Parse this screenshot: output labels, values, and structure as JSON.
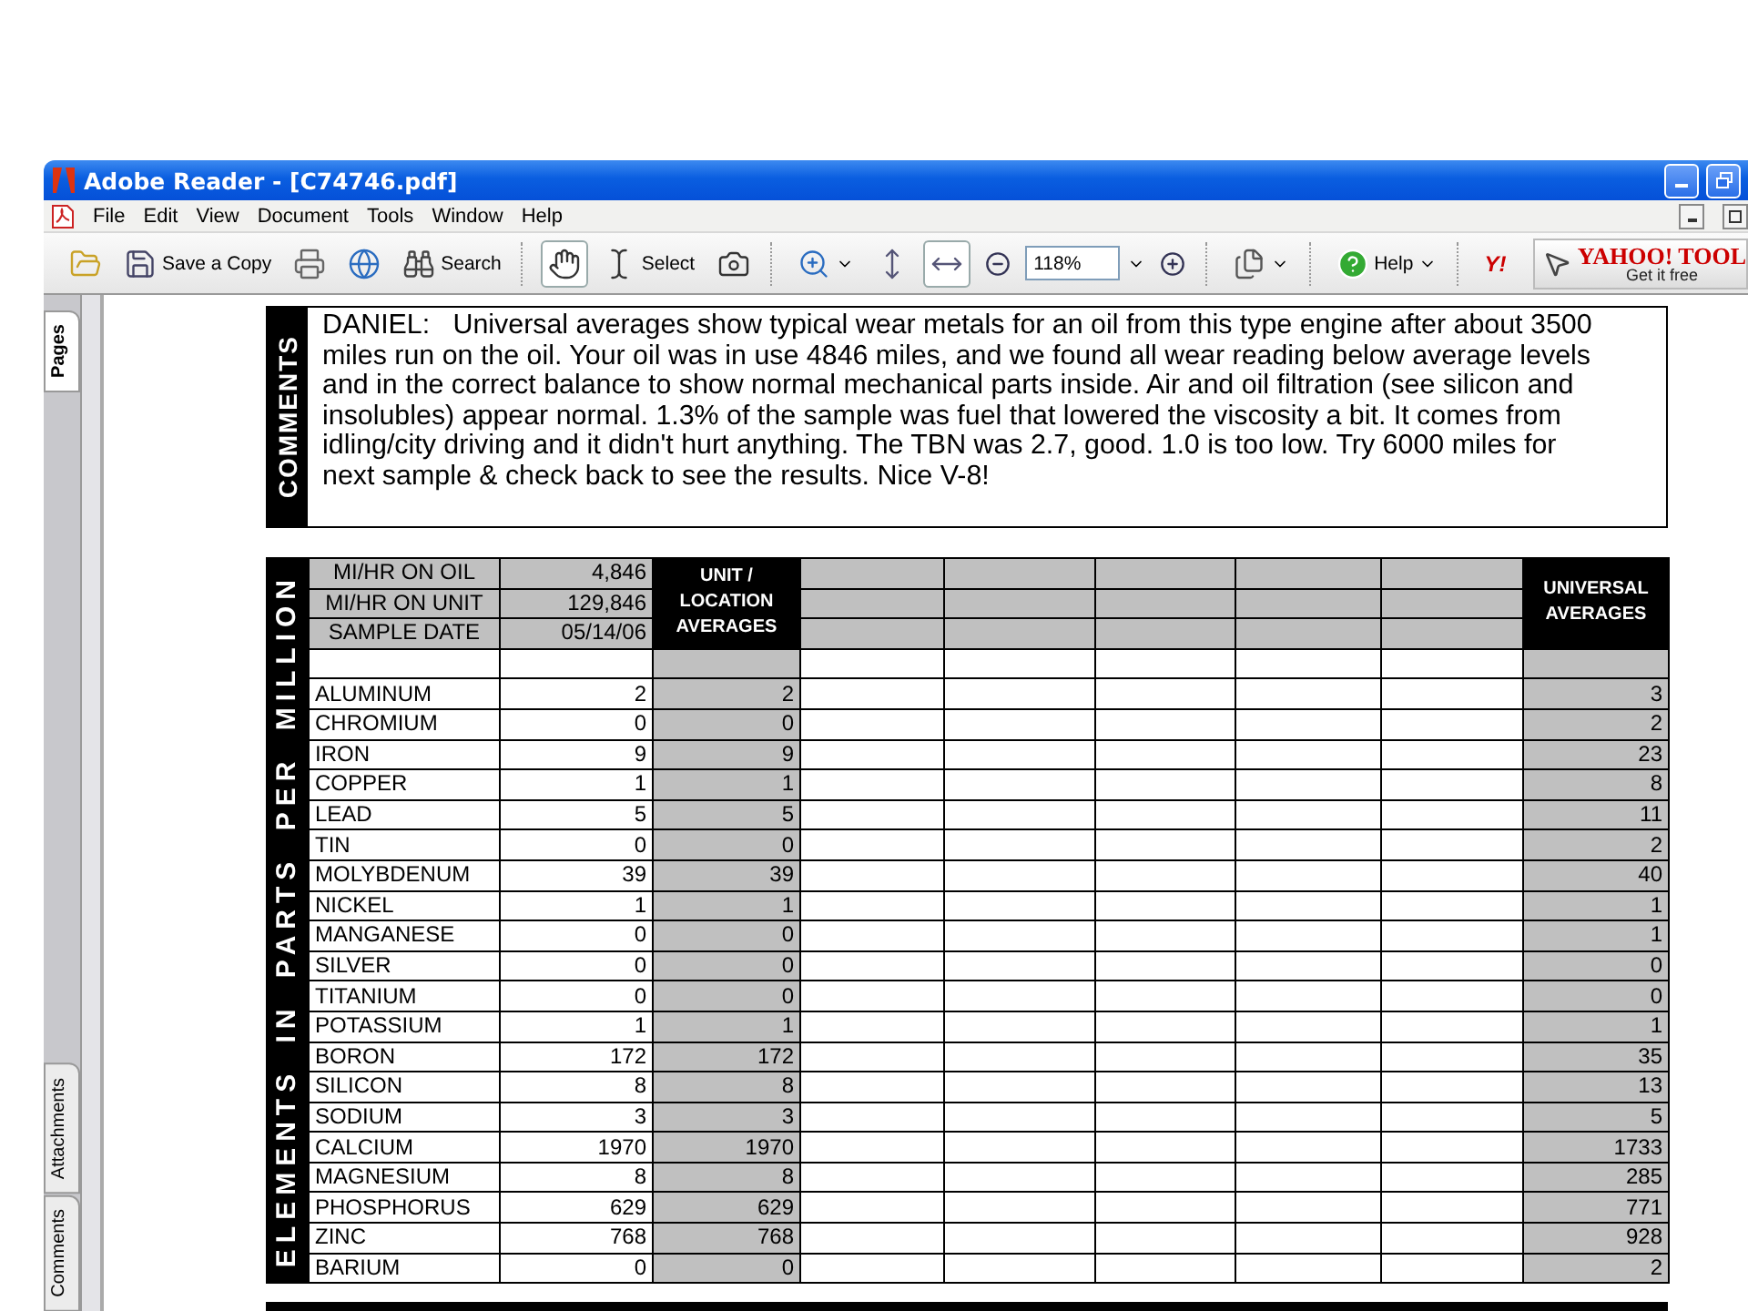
{
  "window": {
    "title": "Adobe Reader - [C74746.pdf]"
  },
  "menu": [
    "File",
    "Edit",
    "View",
    "Document",
    "Tools",
    "Window",
    "Help"
  ],
  "toolbar": {
    "save_copy": {
      "label": "Save a Copy"
    },
    "search": {
      "label": "Search"
    },
    "hand_tool": {
      "selected": true
    },
    "select_tool": {
      "label": "Select",
      "selected": false
    },
    "snapshot_tool": {
      "selected": false
    },
    "fit_page": {
      "selected": false
    },
    "fit_width": {
      "selected": true
    },
    "zoom": {
      "value": "118%"
    },
    "help": {
      "label": "Help"
    },
    "yahoo": {
      "label": "Y!"
    },
    "yahoo_toolbar": {
      "title": "YAHOO! TOOL",
      "subtitle": "Get it free"
    }
  },
  "side_tabs": [
    {
      "label": "Pages",
      "selected": true
    },
    {
      "label": "Attachments",
      "selected": false
    },
    {
      "label": "Comments",
      "selected": false
    }
  ],
  "comments": {
    "heading": "COMMENTS",
    "text": "DANIEL:   Universal averages show typical wear metals for an oil from this type engine after about 3500 miles run on the oil. Your oil was in use 4846 miles, and we found all wear reading below average levels and in the correct balance to show normal mechanical parts inside. Air and oil filtration (see silicon and insolubles) appear normal. 1.3% of the sample was fuel that lowered the viscosity a bit. It comes from idling/city driving and it didn't hurt anything. The TBN was 2.7, good. 1.0 is too low. Try 6000 miles for next sample & check back to see the results. Nice V-8!"
  },
  "report": {
    "side_label": "ELEMENTS IN PARTS PER MILLION",
    "unit_heading": "UNIT / LOCATION AVERAGES",
    "universal_heading": "UNIVERSAL AVERAGES",
    "info": [
      {
        "label": "MI/HR ON OIL",
        "value": "4,846"
      },
      {
        "label": "MI/HR ON UNIT",
        "value": "129,846"
      },
      {
        "label": "SAMPLE DATE",
        "value": "05/14/06"
      }
    ],
    "rows": [
      {
        "element": "ALUMINUM",
        "value": "2",
        "unit": "2",
        "universal": "3"
      },
      {
        "element": "CHROMIUM",
        "value": "0",
        "unit": "0",
        "universal": "2"
      },
      {
        "element": "IRON",
        "value": "9",
        "unit": "9",
        "universal": "23"
      },
      {
        "element": "COPPER",
        "value": "1",
        "unit": "1",
        "universal": "8"
      },
      {
        "element": "LEAD",
        "value": "5",
        "unit": "5",
        "universal": "11"
      },
      {
        "element": "TIN",
        "value": "0",
        "unit": "0",
        "universal": "2"
      },
      {
        "element": "MOLYBDENUM",
        "value": "39",
        "unit": "39",
        "universal": "40"
      },
      {
        "element": "NICKEL",
        "value": "1",
        "unit": "1",
        "universal": "1"
      },
      {
        "element": "MANGANESE",
        "value": "0",
        "unit": "0",
        "universal": "1"
      },
      {
        "element": "SILVER",
        "value": "0",
        "unit": "0",
        "universal": "0"
      },
      {
        "element": "TITANIUM",
        "value": "0",
        "unit": "0",
        "universal": "0"
      },
      {
        "element": "POTASSIUM",
        "value": "1",
        "unit": "1",
        "universal": "1"
      },
      {
        "element": "BORON",
        "value": "172",
        "unit": "172",
        "universal": "35"
      },
      {
        "element": "SILICON",
        "value": "8",
        "unit": "8",
        "universal": "13"
      },
      {
        "element": "SODIUM",
        "value": "3",
        "unit": "3",
        "universal": "5"
      },
      {
        "element": "CALCIUM",
        "value": "1970",
        "unit": "1970",
        "universal": "1733"
      },
      {
        "element": "MAGNESIUM",
        "value": "8",
        "unit": "8",
        "universal": "285"
      },
      {
        "element": "PHOSPHORUS",
        "value": "629",
        "unit": "629",
        "universal": "771"
      },
      {
        "element": "ZINC",
        "value": "768",
        "unit": "768",
        "universal": "928"
      },
      {
        "element": "BARIUM",
        "value": "0",
        "unit": "0",
        "universal": "2"
      }
    ]
  }
}
